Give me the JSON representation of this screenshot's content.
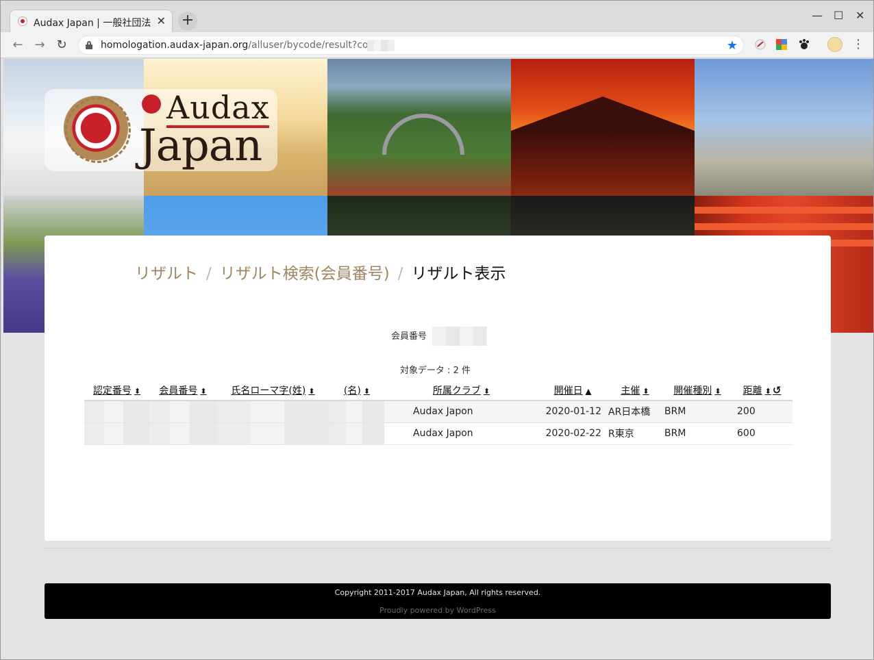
{
  "browser": {
    "tab_title": "Audax Japan | 一般社団法",
    "new_tab_label": "+",
    "url_host": "homologation.audax-japan.org",
    "url_path": "/alluser/bycode/result?code=",
    "win_min": "—",
    "win_max": "☐",
    "win_close": "✕",
    "tab_close": "✕",
    "back": "←",
    "forward": "→",
    "reload": "↻",
    "star": "★",
    "menu": "⋮"
  },
  "logo": {
    "line1": "Audax",
    "line2": "Japan"
  },
  "breadcrumb": {
    "item1": "リザルト",
    "item2": "リザルト検索(会員番号)",
    "current": "リザルト表示",
    "separator": "/"
  },
  "member_label": "会員番号",
  "count_text": "対象データ : 2 件",
  "table": {
    "headers": [
      "認定番号",
      "会員番号",
      "氏名ローマ字(姓)",
      "(名)",
      "所属クラブ",
      "開催日",
      "主催",
      "開催種別",
      "距離"
    ],
    "sort_both": "⬍",
    "sort_asc": "▲",
    "reload_icon": "↺",
    "rows": [
      {
        "club": "Audax Japon",
        "date": "2020-01-12",
        "organizer": "AR日本橋",
        "type": "BRM",
        "distance": "200"
      },
      {
        "club": "Audax Japon",
        "date": "2020-02-22",
        "organizer": "R東京",
        "type": "BRM",
        "distance": "600"
      }
    ]
  },
  "footer": {
    "copyright": "Copyright 2011-2017 Audax Japan, All rights reserved.",
    "powered": "Proudly powered by WordPress"
  },
  "colors": {
    "brand_red": "#c8202a",
    "breadcrumb_link": "#a08660",
    "bookmark_blue": "#1a73e8"
  }
}
